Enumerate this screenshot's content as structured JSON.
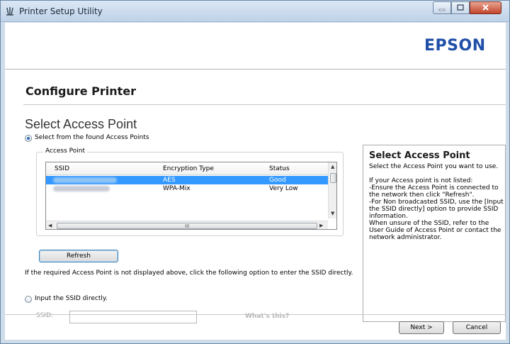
{
  "window": {
    "title": "Printer Setup Utility"
  },
  "header": {
    "logo": "EPSON"
  },
  "page": {
    "title": "Configure Printer",
    "section_title": "Select Access Point"
  },
  "options": {
    "found_label": "Select from the found Access Points",
    "direct_label": "Input the SSID directly."
  },
  "access_point": {
    "group_label": "Access Point",
    "columns": {
      "ssid": "SSID",
      "encryption": "Encryption Type",
      "status": "Status"
    },
    "rows": [
      {
        "ssid": "",
        "encryption": "AES",
        "status": "Good",
        "selected": true
      },
      {
        "ssid": "",
        "encryption": "WPA-Mix",
        "status": "Very Low",
        "selected": false
      }
    ],
    "scroll_grip": "III"
  },
  "buttons": {
    "refresh": "Refresh",
    "next": "Next >",
    "cancel": "Cancel"
  },
  "info": {
    "text": "If the required Access Point is not displayed above, click the following option to enter the SSID directly."
  },
  "ssid_input": {
    "label": "SSID:",
    "value": "",
    "whats_this": "What's this?"
  },
  "help": {
    "title": "Select Access Point",
    "text": "Select the Access Point you want to use.\n\nIf your Access point is not listed:\n-Ensure the Access Point is connected to the network then click \"Refresh\".\n-For Non broadcasted SSID, use the [Input the SSID directly] option to provide SSID information.\nWhen unsure of the SSID, refer to the User Guide of Access Point or contact the network administrator."
  },
  "colors": {
    "brand": "#1f4fa8",
    "selection": "#3399ff"
  }
}
